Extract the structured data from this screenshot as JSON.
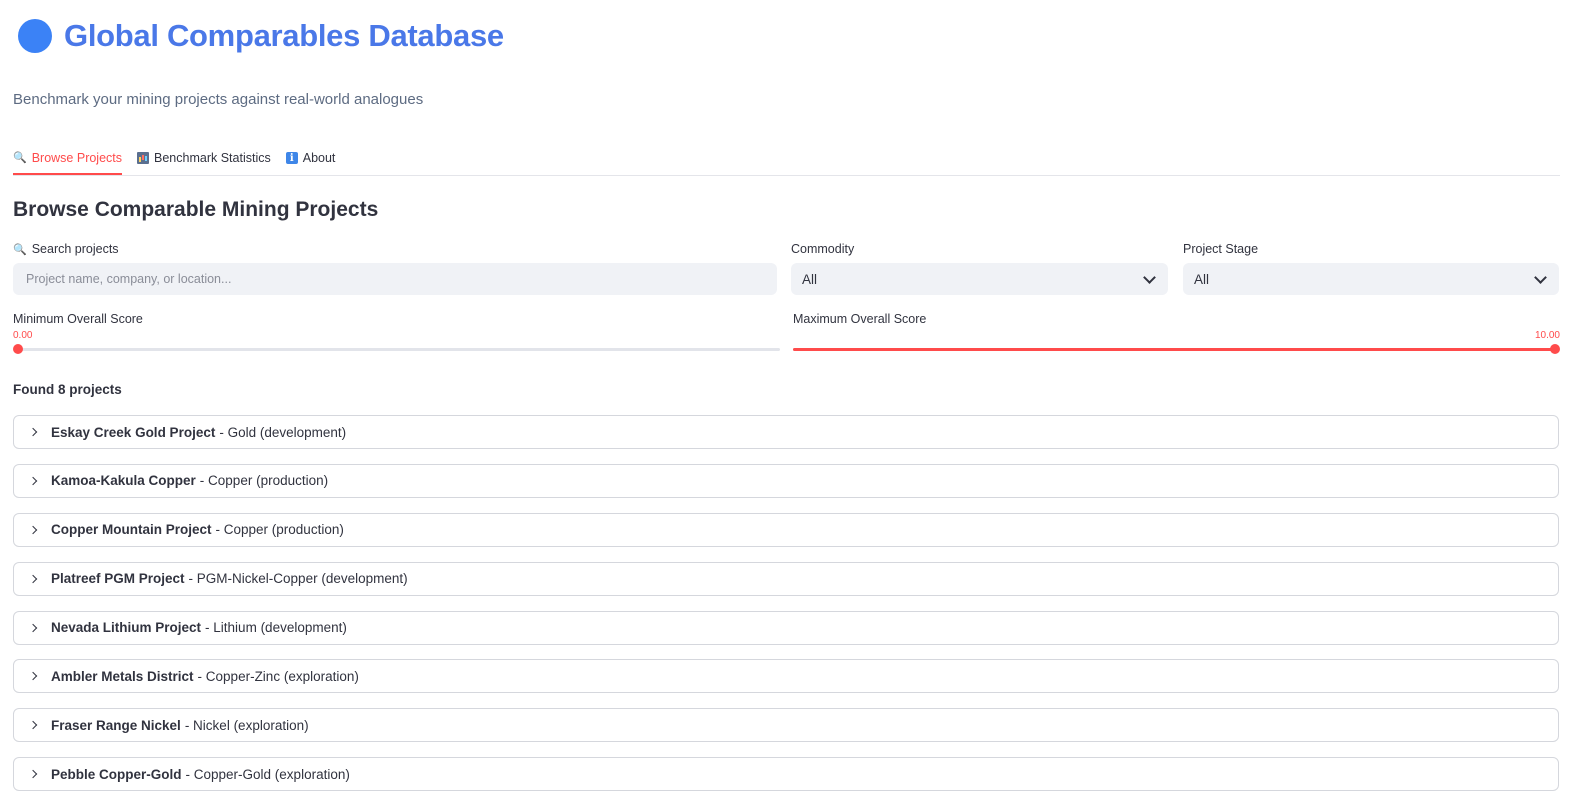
{
  "header": {
    "title": "Global Comparables Database",
    "subtitle": "Benchmark your mining projects against real-world analogues"
  },
  "tabs": [
    {
      "label": "Browse Projects",
      "active": true
    },
    {
      "label": "Benchmark Statistics",
      "active": false
    },
    {
      "label": "About",
      "active": false
    }
  ],
  "section_title": "Browse Comparable Mining Projects",
  "filters": {
    "search_label": "Search projects",
    "search_placeholder": "Project name, company, or location...",
    "search_value": "",
    "commodity_label": "Commodity",
    "commodity_value": "All",
    "stage_label": "Project Stage",
    "stage_value": "All",
    "min_score_label": "Minimum Overall Score",
    "min_score_value": "0.00",
    "min_score_fraction": 0,
    "max_score_label": "Maximum Overall Score",
    "max_score_value": "10.00",
    "max_score_fraction": 1
  },
  "results": {
    "found_text": "Found 8 projects",
    "projects": [
      {
        "name": "Eskay Creek Gold Project",
        "detail": "- Gold (development)"
      },
      {
        "name": "Kamoa-Kakula Copper",
        "detail": "- Copper (production)"
      },
      {
        "name": "Copper Mountain Project",
        "detail": "- Copper (production)"
      },
      {
        "name": "Platreef PGM Project",
        "detail": "- PGM-Nickel-Copper (development)"
      },
      {
        "name": "Nevada Lithium Project",
        "detail": "- Lithium (development)"
      },
      {
        "name": "Ambler Metals District",
        "detail": "- Copper-Zinc (exploration)"
      },
      {
        "name": "Fraser Range Nickel",
        "detail": "- Nickel (exploration)"
      },
      {
        "name": "Pebble Copper-Gold",
        "detail": "- Copper-Gold (exploration)"
      }
    ]
  },
  "colors": {
    "accent": "#ff4b4b",
    "title": "#4a78e8",
    "header_icon": "#3b82f6"
  },
  "icons": {
    "header": "blue-circle-icon",
    "search": "magnifier-icon",
    "stats": "bar-chart-icon",
    "about": "info-icon"
  }
}
